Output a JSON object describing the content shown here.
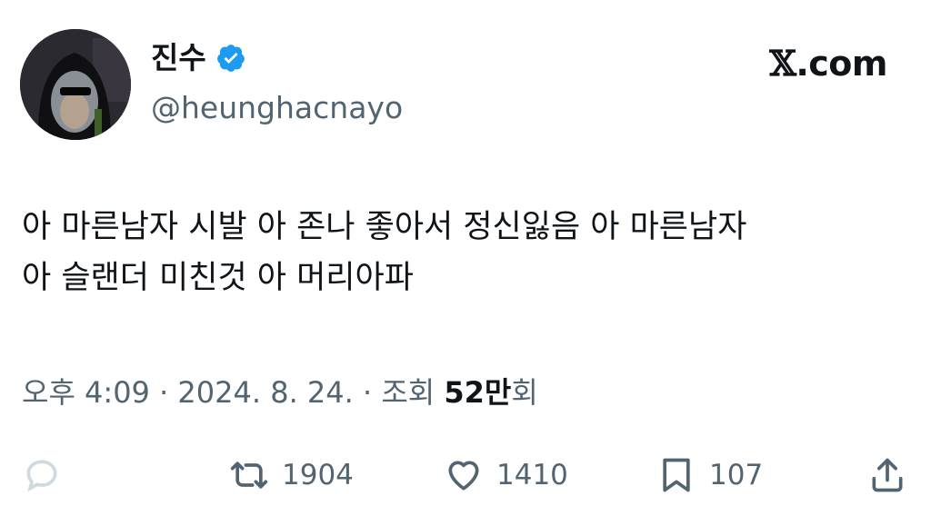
{
  "author": {
    "display_name": "진수",
    "handle": "@heunghacnayo",
    "verified": true,
    "verified_color": "#1d9bf0"
  },
  "brand": {
    "x_glyph": "𝕏",
    "label": ".com"
  },
  "tweet": {
    "lines": [
      "아 마른남자 시발 아 존나 좋아서 정신잃음 아 마른남자",
      "아 슬랜더 미친것 아 머리아파"
    ]
  },
  "meta": {
    "time": "오후 4:09 · 2024. 8. 24. · 조회 ",
    "views_count": "52만",
    "views_suffix": "회"
  },
  "actions": {
    "reply": {
      "icon": "reply-icon"
    },
    "retweet": {
      "icon": "retweet-icon",
      "count": "1904"
    },
    "like": {
      "icon": "heart-icon",
      "count": "1410"
    },
    "bookmark": {
      "icon": "bookmark-icon",
      "count": "107"
    },
    "share": {
      "icon": "share-icon"
    }
  },
  "colors": {
    "text": "#0f1419",
    "muted": "#536471",
    "reply_icon": "#cfd9de"
  }
}
